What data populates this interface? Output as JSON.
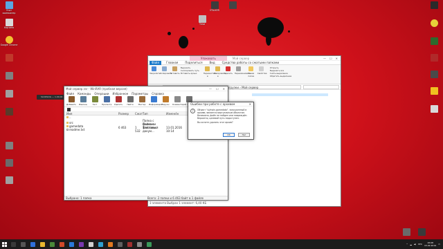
{
  "desktop": {
    "icons": [
      {
        "label": "Этот компьютер",
        "color": "#5aa6e0"
      },
      {
        "label": "Корзина",
        "color": "#d9d9d9"
      },
      {
        "label": "Google Chrome",
        "color": "#f2c230"
      },
      {
        "label": "",
        "color": "#c0392b"
      },
      {
        "label": "",
        "color": "#808080"
      },
      {
        "label": "",
        "color": "#a0a0a0"
      },
      {
        "label": "",
        "color": "#5a3a2a"
      },
      {
        "label": "",
        "color": "#808080"
      },
      {
        "label": "STALKER",
        "color": "#3c3c3c"
      },
      {
        "label": "Тени",
        "color": "#c0c0c0"
      },
      {
        "label": "",
        "color": "#444444"
      },
      {
        "label": "",
        "color": "#2a2a2a"
      },
      {
        "label": "",
        "color": "#e8d13a"
      },
      {
        "label": "",
        "color": "#2d6a2d"
      },
      {
        "label": "",
        "color": "#b02a2a"
      },
      {
        "label": "",
        "color": "#4a4a4a"
      },
      {
        "label": "",
        "color": "#f0c020"
      },
      {
        "label": "",
        "color": "#d9d9d9"
      },
      {
        "label": "",
        "color": "#2f5fa0"
      },
      {
        "label": "",
        "color": "#3a3a3a"
      },
      {
        "label": "",
        "color": "#6a6a6a"
      }
    ],
    "floating_label": "SLOWLOG — 1.00.00"
  },
  "explorer": {
    "context_tab": "Упаковать",
    "title": "Мой сервер",
    "ribbon_tabs": [
      "Файл",
      "Главная",
      "Поделиться",
      "Вид",
      "Средства работы со сжатыми папками"
    ],
    "ribbon_left": [
      "Закрепить",
      "Копировать",
      "Вставить"
    ],
    "ribbon_small": [
      "Вырезать",
      "Скопировать путь",
      "Вставить ярлык"
    ],
    "ribbon_mid": [
      "Переместить в",
      "Копировать в",
      "Удалить",
      "Переименовать"
    ],
    "ribbon_new": [
      "Новая папка",
      "Свойства"
    ],
    "ribbon_right": [
      "Открыть",
      "Выделить все",
      "Снять выделение",
      "Обратить выделение"
    ],
    "path": "Этот компьютер › Локальный диск (D:) › Загрузки › Мой сервер",
    "status": "3 элемента   Выбран 1 элемент: 6,40 КБ"
  },
  "winrar": {
    "title": "Мой сервер.rar - WinRAR (пробная версия)",
    "menu": [
      "Файл",
      "Команды",
      "Операции",
      "Избранное",
      "Параметры",
      "Справка"
    ],
    "toolbar": [
      {
        "label": "Добавить",
        "color": "#8a5a2c"
      },
      {
        "label": "Извлечь",
        "color": "#5a7d9a"
      },
      {
        "label": "Тест",
        "color": "#7a8a3a"
      },
      {
        "label": "Просмотр",
        "color": "#4a6fa5"
      },
      {
        "label": "Удалить",
        "color": "#b03030"
      },
      {
        "label": "Найти",
        "color": "#6a6a6a"
      },
      {
        "label": "Мастер",
        "color": "#9a6a3a"
      },
      {
        "label": "Информация",
        "color": "#3a7ad0"
      },
      {
        "label": "Вирусы",
        "color": "#c07a2a"
      },
      {
        "label": "Комментарий",
        "color": "#8a8a8a"
      },
      {
        "label": "SFX",
        "color": "#707070"
      }
    ],
    "columns": [
      "Имя",
      "Размер",
      "Сжат",
      "Тип",
      "Изменён",
      "CRC32"
    ],
    "rows": [
      {
        "name": "..",
        "size": "",
        "packed": "",
        "type": "",
        "modified": "",
        "crc": "",
        "color": "#e8c060"
      },
      {
        "name": "src",
        "size": "",
        "packed": "",
        "type": "Папка с файлами",
        "modified": "",
        "crc": "",
        "color": "#e8c060"
      },
      {
        "name": "gamedata",
        "size": "",
        "packed": "",
        "type": "Папка с файлами",
        "modified": "",
        "crc": "",
        "color": "#e8c060"
      },
      {
        "name": "readme.txt",
        "size": "6 463",
        "packed": "1 532",
        "type": "Текстовый докум...",
        "modified": "13.01.2016 10:14",
        "crc": "6C7C...",
        "color": "#eeeeee"
      }
    ],
    "status_left": "Выбрано: 1 папка",
    "status_right": "Всего: 2 папки и 6 463 байт в 1 файле"
  },
  "dialog": {
    "title": "Ошибки при работе с архивом",
    "message": "Объект \"ui/main.gamedata\", загруженный в архиве, является виртуальным объектом. Возможно, файл не найден или повреждён. Вероятно, целевой путь недоступен.",
    "question": "Вы хотите удалить этот архив?",
    "ok": "ОК",
    "no": "Нет"
  },
  "taskbar": {
    "time": "18:08",
    "date": "15.02.2019",
    "lang": "РУС",
    "icons": [
      "#3a3a3a",
      "#555555",
      "#2f6fd8",
      "#e8b830",
      "#4a8a3a",
      "#d04a2a",
      "#2a7ad8",
      "#7a3ab0",
      "#d0d0d0",
      "#30a0d0",
      "#e07a20",
      "#606060",
      "#a03030",
      "#8a8a8a",
      "#3a9a5a"
    ]
  }
}
